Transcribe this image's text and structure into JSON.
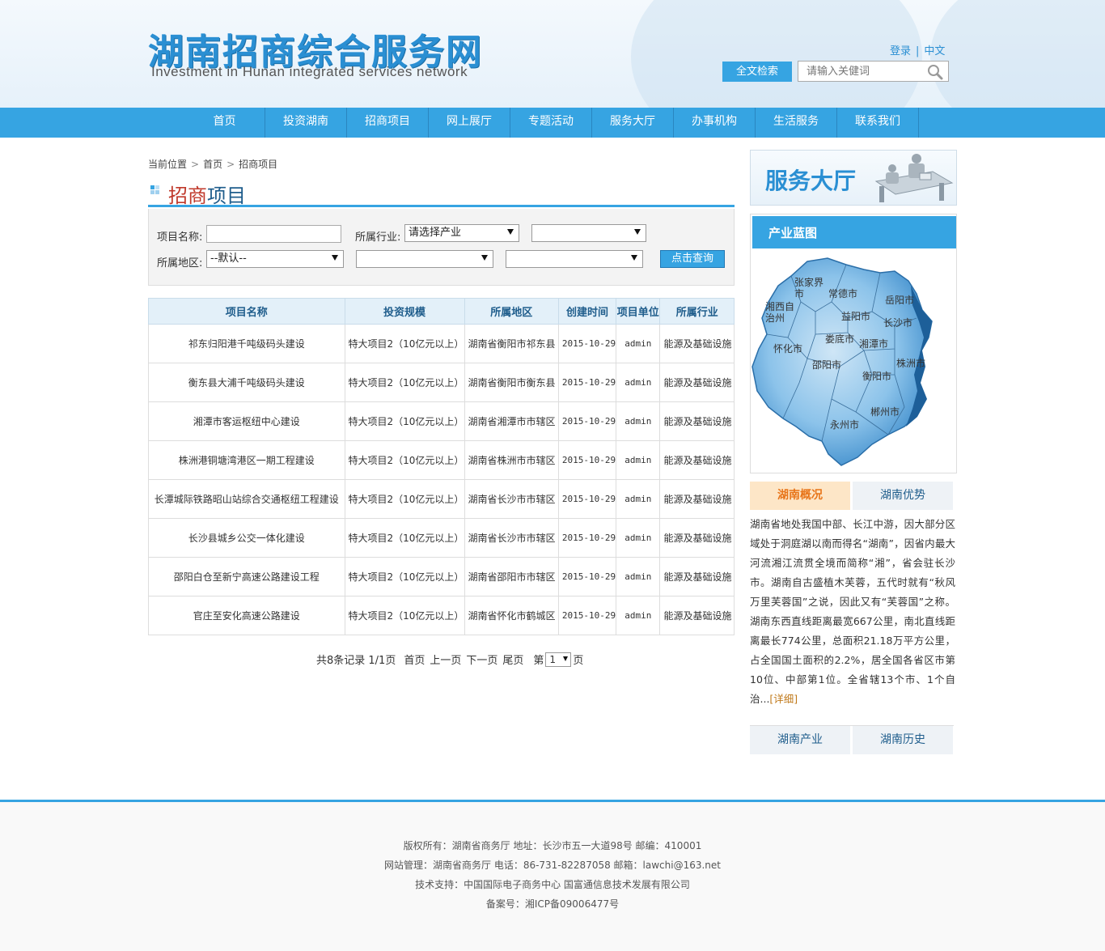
{
  "header": {
    "logo_cn": "湖南招商综合服务网",
    "logo_en": "Investment in Hunan integrated services network",
    "login": "登录",
    "separator": "|",
    "lang": "中文",
    "search_button": "全文检索",
    "search_placeholder": "请输入关健词"
  },
  "nav": [
    "首页",
    "投资湖南",
    "招商项目",
    "网上展厅",
    "专题活动",
    "服务大厅",
    "办事机构",
    "生活服务",
    "联系我们"
  ],
  "breadcrumb": {
    "label": "当前位置",
    "home": "首页",
    "current": "招商项目"
  },
  "section_title": {
    "part1": "招商",
    "part2": "项目"
  },
  "filter": {
    "name_label": "项目名称:",
    "industry_label": "所属行业:",
    "industry_select": "请选择产业",
    "industry_sub_select": "",
    "region_label": "所属地区:",
    "region_select": "--默认--",
    "region_sub1": "",
    "region_sub2": "",
    "query_button": "点击查询"
  },
  "table": {
    "headers": [
      "项目名称",
      "投资规模",
      "所属地区",
      "创建时间",
      "项目单位",
      "所属行业"
    ],
    "rows": [
      [
        "祁东归阳港千吨级码头建设",
        "特大项目2（10亿元以上）",
        "湖南省衡阳市祁东县",
        "2015-10-29",
        "admin",
        "能源及基础设施"
      ],
      [
        "衡东县大浦千吨级码头建设",
        "特大项目2（10亿元以上）",
        "湖南省衡阳市衡东县",
        "2015-10-29",
        "admin",
        "能源及基础设施"
      ],
      [
        "湘潭市客运枢纽中心建设",
        "特大项目2（10亿元以上）",
        "湖南省湘潭市市辖区",
        "2015-10-29",
        "admin",
        "能源及基础设施"
      ],
      [
        "株洲港铜塘湾港区一期工程建设",
        "特大项目2（10亿元以上）",
        "湖南省株洲市市辖区",
        "2015-10-29",
        "admin",
        "能源及基础设施"
      ],
      [
        "长潭城际铁路昭山站综合交通枢纽工程建设",
        "特大项目2（10亿元以上）",
        "湖南省长沙市市辖区",
        "2015-10-29",
        "admin",
        "能源及基础设施"
      ],
      [
        "长沙县城乡公交一体化建设",
        "特大项目2（10亿元以上）",
        "湖南省长沙市市辖区",
        "2015-10-29",
        "admin",
        "能源及基础设施"
      ],
      [
        "邵阳白仓至新宁高速公路建设工程",
        "特大项目2（10亿元以上）",
        "湖南省邵阳市市辖区",
        "2015-10-29",
        "admin",
        "能源及基础设施"
      ],
      [
        "官庄至安化高速公路建设",
        "特大项目2（10亿元以上）",
        "湖南省怀化市鹤城区",
        "2015-10-29",
        "admin",
        "能源及基础设施"
      ]
    ]
  },
  "pager": {
    "summary": "共8条记录 1/1页",
    "first": "首页",
    "prev": "上一页",
    "next": "下一页",
    "last": "尾页",
    "go_prefix": "第",
    "page": "1",
    "go_suffix": "页"
  },
  "sidebar": {
    "hall_banner": "服务大厅",
    "map_title": "产业蓝图",
    "map_labels": [
      "张家界市",
      "常德市",
      "岳阳市",
      "湘西自治州",
      "益阳市",
      "长沙市",
      "怀化市",
      "娄底市",
      "湘潭市",
      "株洲市",
      "邵阳市",
      "衡阳市",
      "郴州市",
      "永州市"
    ],
    "tab_active": "湖南概况",
    "tab_inactive": "湖南优势",
    "intro": "湖南省地处我国中部、长江中游，因大部分区域处于洞庭湖以南而得名“湖南”，因省内最大河流湘江流贯全境而简称“湘”，省会驻长沙市。湖南自古盛植木芙蓉，五代时就有“秋风万里芙蓉国”之说，因此又有“芙蓉国”之称。湖南东西直线距离最宽667公里，南北直线距离最长774公里，总面积21.18万平方公里，占全国国土面积的2.2%，居全国各省区市第10位、中部第1位。全省辖13个市、1个自治...",
    "intro_more": "[详细]",
    "tab3": "湖南产业",
    "tab4": "湖南历史"
  },
  "footer": {
    "line1": "版权所有：湖南省商务厅 地址：长沙市五一大道98号 邮编：410001",
    "line2": "网站管理：湖南省商务厅 电话：86-731-82287058 邮箱：lawchi@163.net",
    "line3": "技术支持：中国国际电子商务中心 国富通信息技术发展有限公司",
    "line4": "备案号：湘ICP备09006477号"
  },
  "colors": {
    "accent": "#36a4e2",
    "title_red": "#c0392b",
    "title_blue": "#1f5d8c",
    "tab_orange": "#e8751a"
  }
}
